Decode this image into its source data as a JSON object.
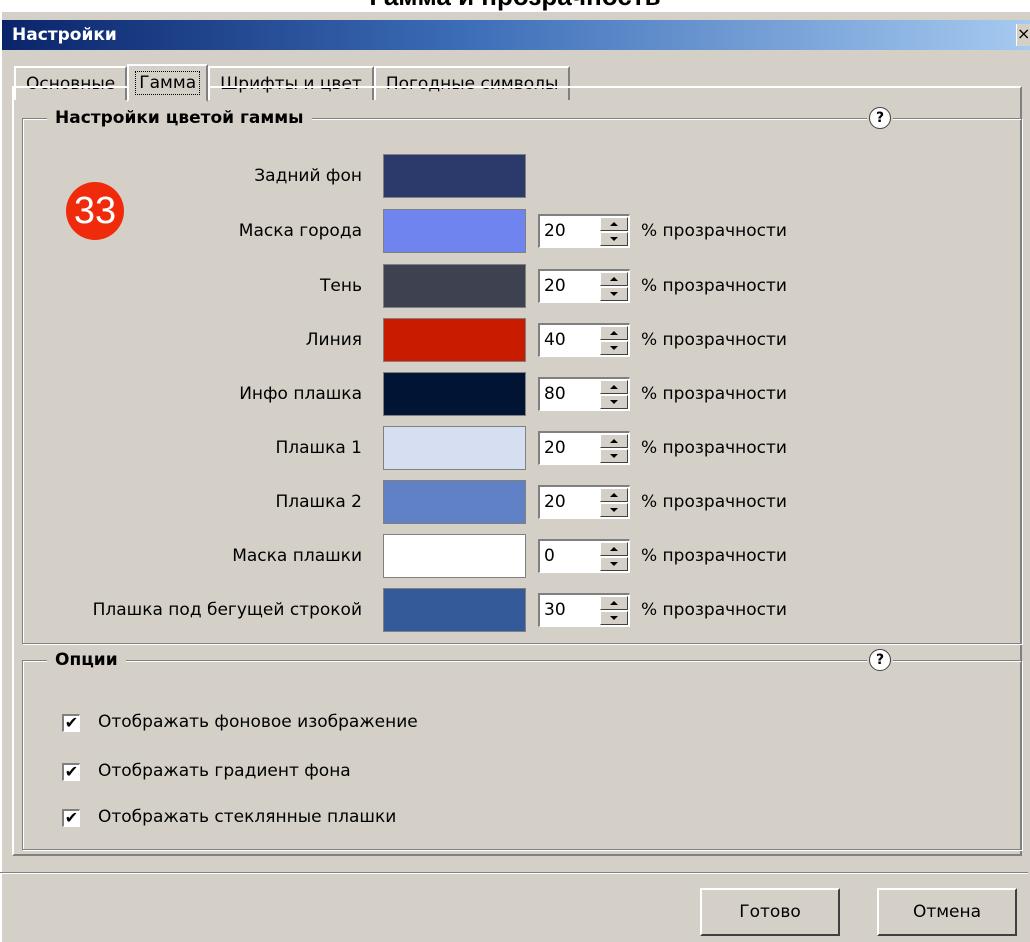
{
  "page_caption": "Гамма и прозрачность",
  "window": {
    "title": "Настройки",
    "close_glyph": "×"
  },
  "tabs": [
    {
      "label": "Основные",
      "active": false
    },
    {
      "label": "Гамма",
      "active": true
    },
    {
      "label": "Шрифты и цвет",
      "active": false
    },
    {
      "label": "Погодные символы",
      "active": false
    }
  ],
  "badge": {
    "number": "33",
    "color": "#ef2b0c"
  },
  "color_group": {
    "legend": "Настройки цветой гаммы",
    "help": "?",
    "rows": [
      {
        "label": "Задний фон",
        "color": "#2b3a6b",
        "value": null
      },
      {
        "label": "Маска города",
        "color": "#6f84ee",
        "value": "20",
        "suffix": "% прозрачности"
      },
      {
        "label": "Тень",
        "color": "#3d4150",
        "value": "20",
        "suffix": "% прозрачности"
      },
      {
        "label": "Линия",
        "color": "#c81b00",
        "value": "40",
        "suffix": "% прозрачности"
      },
      {
        "label": "Инфо плашка",
        "color": "#021433",
        "value": "80",
        "suffix": "% прозрачности"
      },
      {
        "label": "Плашка 1",
        "color": "#d6dff2",
        "value": "20",
        "suffix": "% прозрачности"
      },
      {
        "label": "Плашка 2",
        "color": "#6181c6",
        "value": "20",
        "suffix": "% прозрачности"
      },
      {
        "label": "Маска плашки",
        "color": "#ffffff",
        "value": "0",
        "suffix": "% прозрачности"
      },
      {
        "label": "Плашка под бегущей строкой",
        "color": "#345a9a",
        "value": "30",
        "suffix": "% прозрачности"
      }
    ]
  },
  "options_group": {
    "legend": "Опции",
    "help": "?",
    "checks": [
      {
        "label": "Отображать фоновое изображение",
        "checked": true
      },
      {
        "label": "Отображать градиент фона",
        "checked": true
      },
      {
        "label": "Отображать стеклянные плашки",
        "checked": true
      }
    ]
  },
  "buttons": {
    "ok": "Готово",
    "cancel": "Отмена"
  }
}
